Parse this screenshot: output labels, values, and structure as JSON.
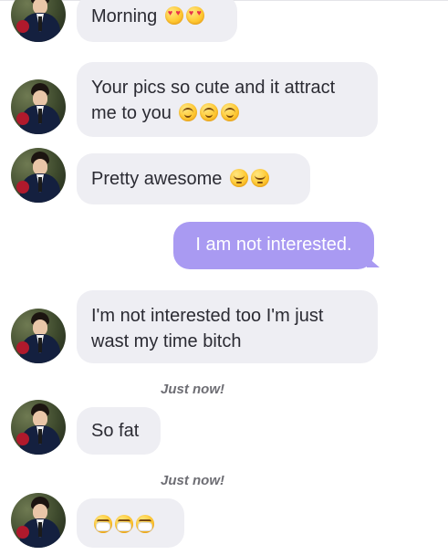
{
  "thread": {
    "messages": [
      {
        "side": "in",
        "text": "Morning",
        "emoji": [
          "heart-eyes-emoji",
          "heart-eyes-emoji"
        ]
      },
      {
        "side": "in",
        "text_line1": "Your pics so cute and it attract",
        "text_line2": "me to you",
        "emoji": [
          "blush-emoji",
          "blush-emoji",
          "blush-emoji"
        ]
      },
      {
        "side": "in",
        "text": "Pretty awesome",
        "emoji": [
          "relieved-emoji",
          "relieved-emoji"
        ]
      },
      {
        "side": "out",
        "text": "I am not interested."
      },
      {
        "side": "in",
        "text_line1": "I'm not interested too I'm just",
        "text_line2": "wast my time bitch"
      },
      {
        "side": "in",
        "text": "So fat",
        "timestamp": "Just now!"
      },
      {
        "side": "in",
        "text": "",
        "emoji": [
          "mask-emoji",
          "mask-emoji",
          "mask-emoji"
        ],
        "timestamp": "Just now!"
      }
    ]
  },
  "colors": {
    "incoming_bubble": "#eeeef3",
    "outgoing_bubble": "#a99af2",
    "timestamp_text": "#6e6e74"
  }
}
